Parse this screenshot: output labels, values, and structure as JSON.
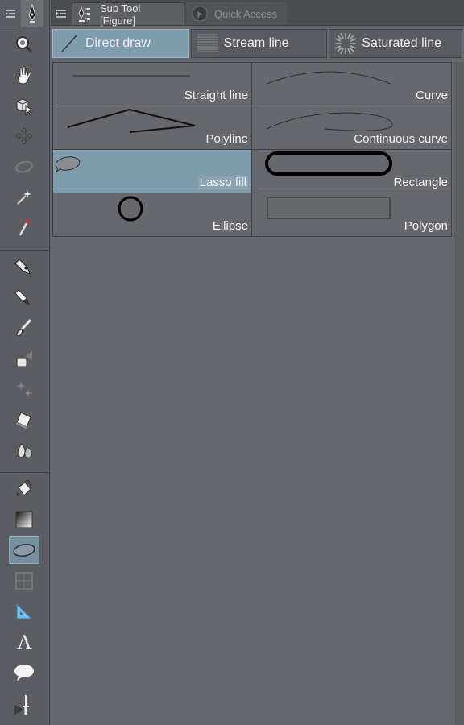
{
  "toolbar": {
    "tools": [
      {
        "name": "zoom-icon"
      },
      {
        "name": "hand-icon"
      },
      {
        "name": "operation-icon"
      },
      {
        "name": "move-layer-icon"
      },
      {
        "name": "selection-icon"
      },
      {
        "name": "auto-select-icon"
      },
      {
        "name": "eyedropper-icon"
      },
      {
        "name": "pen-icon"
      },
      {
        "name": "pencil-icon"
      },
      {
        "name": "brush-icon"
      },
      {
        "name": "airbrush-icon"
      },
      {
        "name": "decoration-icon"
      },
      {
        "name": "eraser-icon"
      },
      {
        "name": "blend-icon"
      },
      {
        "name": "fill-icon"
      },
      {
        "name": "gradient-icon"
      },
      {
        "name": "figure-icon",
        "selected": true
      },
      {
        "name": "frame-border-icon"
      },
      {
        "name": "ruler-icon"
      },
      {
        "name": "text-icon"
      },
      {
        "name": "balloon-icon"
      },
      {
        "name": "correct-line-icon"
      }
    ]
  },
  "tabs": {
    "active_label": "Sub Tool [Figure]",
    "inactive_label": "Quick Access"
  },
  "groups": [
    {
      "label": "Direct draw",
      "active": true
    },
    {
      "label": "Stream line",
      "active": false
    },
    {
      "label": "Saturated line",
      "active": false
    }
  ],
  "subtools": [
    {
      "label": "Straight line",
      "preview": "straight-line-preview"
    },
    {
      "label": "Curve",
      "preview": "curve-preview"
    },
    {
      "label": "Polyline",
      "preview": "polyline-preview"
    },
    {
      "label": "Continuous curve",
      "preview": "continuous-curve-preview"
    },
    {
      "label": "Lasso fill",
      "preview": "lasso-fill-preview",
      "selected": true
    },
    {
      "label": "Rectangle",
      "preview": "rectangle-preview"
    },
    {
      "label": "Ellipse",
      "preview": "ellipse-preview"
    },
    {
      "label": "Polygon",
      "preview": "polygon-preview"
    }
  ],
  "colors": {
    "selected": "#7f9cae",
    "panel_bg": "#66686d"
  }
}
